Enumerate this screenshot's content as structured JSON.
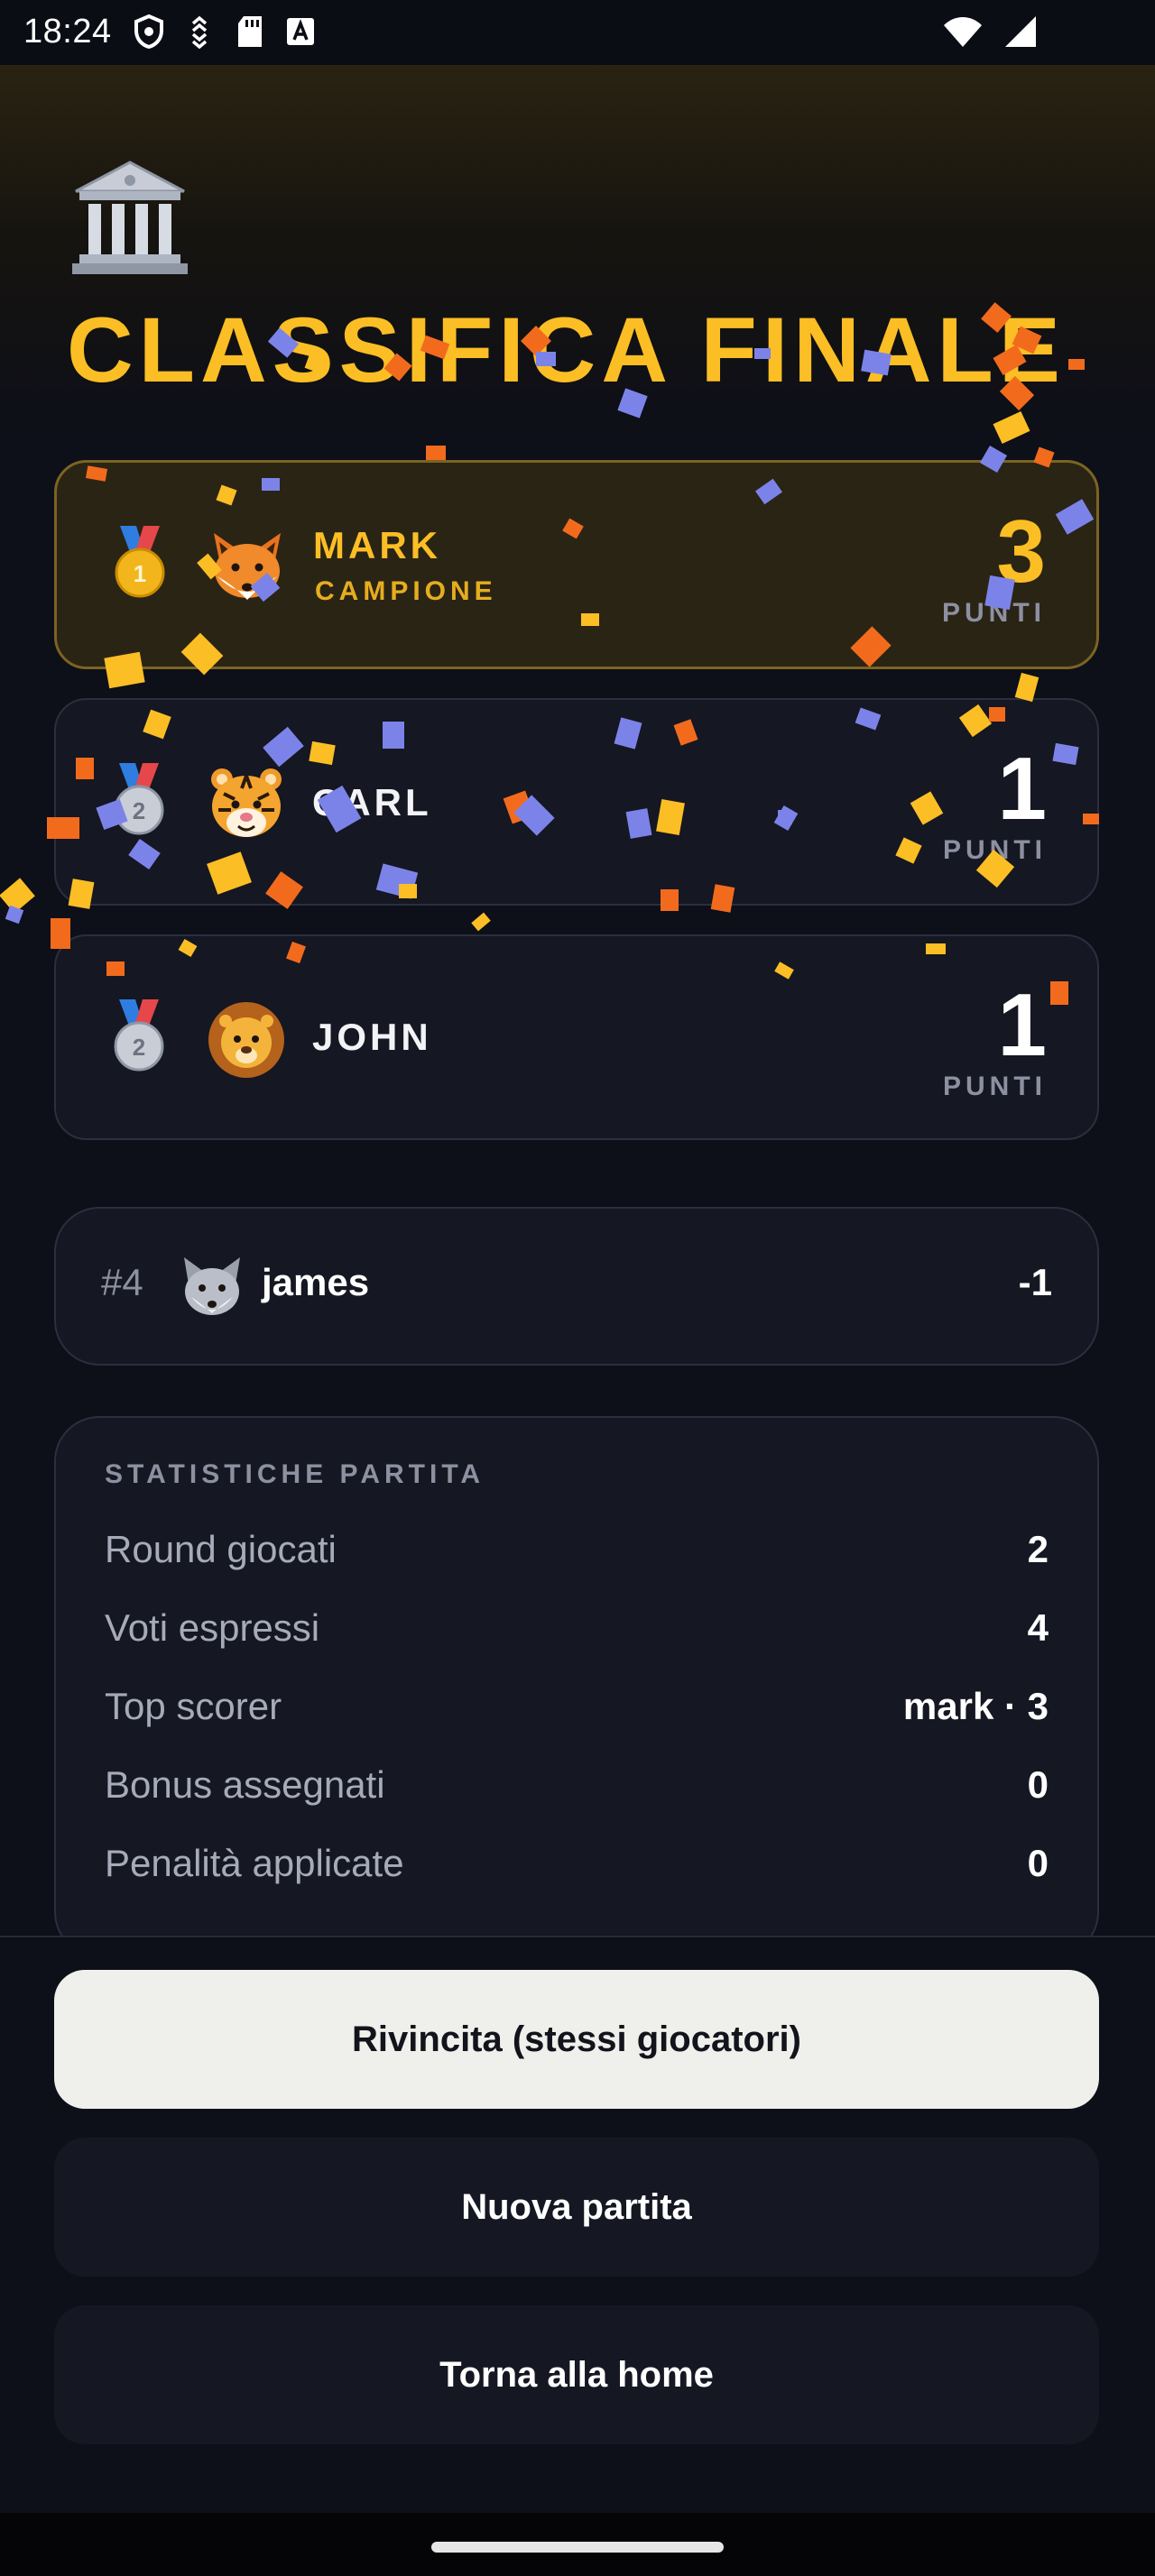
{
  "status_bar": {
    "time": "18:24"
  },
  "header": {
    "title": "CLASSIFICA FINALE"
  },
  "podium": [
    {
      "rank": 1,
      "medal": "gold-medal-icon",
      "animal": "fox-icon",
      "name": "MARK",
      "subtitle": "CAMPIONE",
      "points": "3",
      "points_label": "PUNTI"
    },
    {
      "rank": 2,
      "medal": "silver-medal-icon",
      "animal": "tiger-icon",
      "name": "CARL",
      "points": "1",
      "points_label": "PUNTI"
    },
    {
      "rank": 2,
      "medal": "silver-medal-icon",
      "animal": "lion-icon",
      "name": "JOHN",
      "points": "1",
      "points_label": "PUNTI"
    }
  ],
  "others": [
    {
      "position": "#4",
      "animal": "wolf-icon",
      "name": "james",
      "score": "-1"
    }
  ],
  "stats": {
    "heading": "STATISTICHE PARTITA",
    "rows": [
      {
        "label": "Round giocati",
        "value": "2"
      },
      {
        "label": "Voti espressi",
        "value": "4"
      },
      {
        "label": "Top scorer",
        "value": "mark · 3"
      },
      {
        "label": "Bonus assegnati",
        "value": "0"
      },
      {
        "label": "Penalità applicate",
        "value": "0"
      }
    ]
  },
  "actions": {
    "rematch": "Rivincita (stessi giocatori)",
    "new_game": "Nuova partita",
    "home": "Torna alla home"
  },
  "colors": {
    "accent_gold": "#fbbe24",
    "background": "#0d0f19",
    "card": "#151722"
  }
}
